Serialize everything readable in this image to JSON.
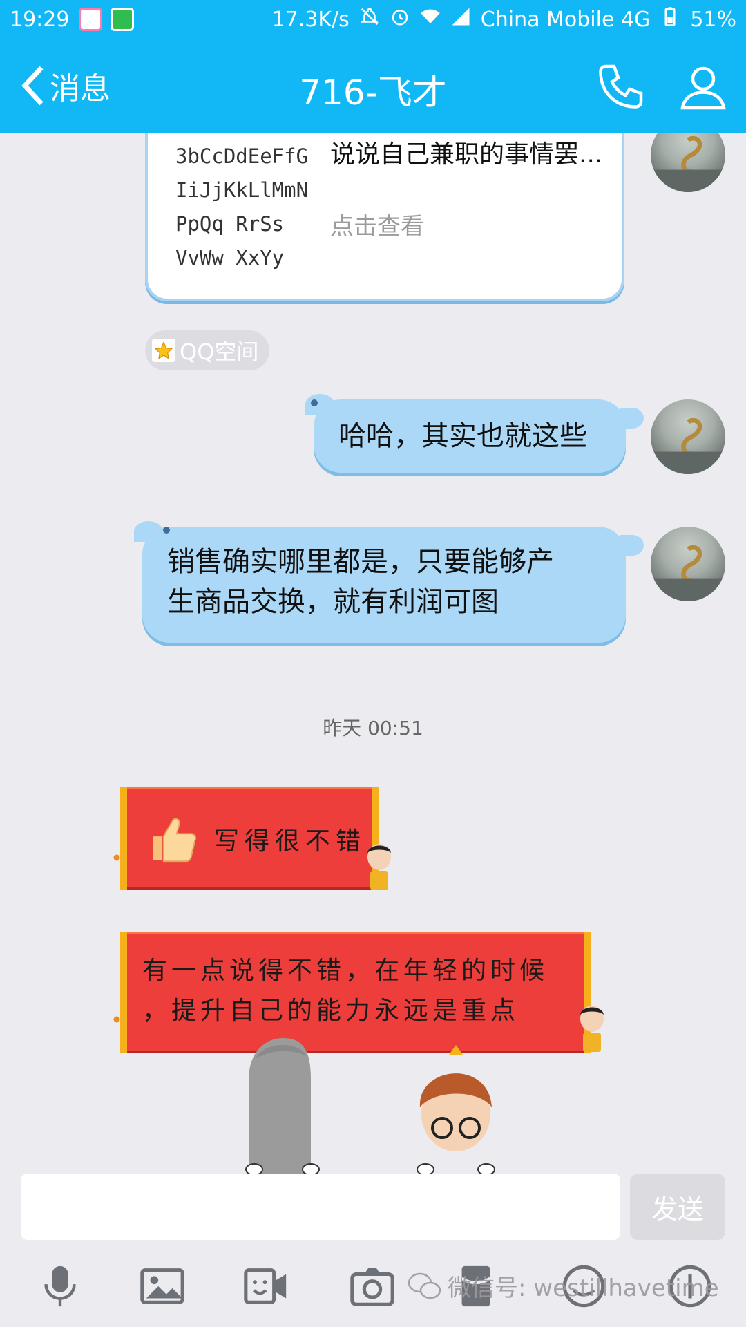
{
  "status_bar": {
    "time": "19:29",
    "network_speed": "17.3K/s",
    "carrier": "China Mobile 4G",
    "battery": "51%"
  },
  "header": {
    "back_label": "消息",
    "title": "716-飞才"
  },
  "messages": {
    "card": {
      "thumb_lines": [
        "3bCcDdEeFfG",
        "IiJjKkLlMmN",
        "PpQq   RrSs",
        "VvWw  XxYy"
      ],
      "title": "说说自己兼职的事情罢...",
      "link": "点击查看"
    },
    "source_tag": "QQ空间",
    "bubble_1": "哈哈，其实也就这些",
    "bubble_2_line1": "销售确实哪里都是，只要能够产",
    "bubble_2_line2": "生商品交换，就有利润可图",
    "timestamp": "昨天 00:51",
    "banner_1": "写得很不错",
    "banner_2_line1": "有一点说得不错，在年轻的时候",
    "banner_2_line2": "，提升自己的能力永远是重点"
  },
  "input": {
    "placeholder": "",
    "send_label": "发送"
  },
  "toolbar": {
    "icons": [
      "microphone-icon",
      "image-icon",
      "video-call-icon",
      "camera-icon",
      "red-packet-icon",
      "emoji-icon",
      "more-icon"
    ]
  },
  "watermark": "微信号: westillhavetime",
  "colors": {
    "accent": "#12b7f5",
    "bubble": "#abd8f7",
    "banner": "#ee3e3b"
  }
}
